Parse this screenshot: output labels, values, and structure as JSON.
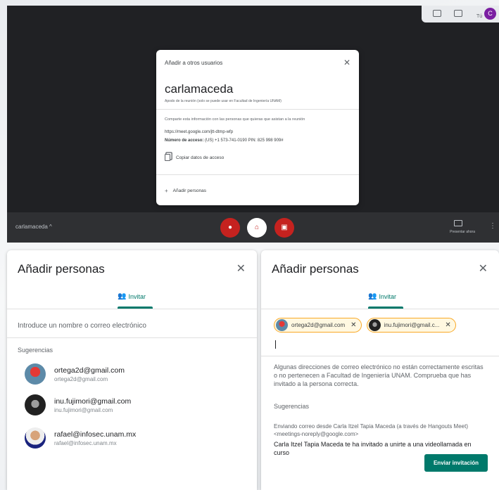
{
  "meet": {
    "top_icons": [
      "people-icon",
      "chat-icon",
      "activities-icon"
    ],
    "top_tu": "Tú",
    "top_avatar": "C",
    "dialog": {
      "title": "Añadir a otros usuarios",
      "meeting_name": "carlamaceda",
      "meeting_sub": "Apodo de la reunión (solo se puede usar en Facultad de Ingeniería UNAM)",
      "share_text": "Comparte esta información con las personas que quieras que asistan a la reunión",
      "link": "https://meet.google.com/jtt-dtmp-wfp",
      "access_label": "Número de acceso:",
      "access_value": "(US) +1 573-741-0190  PIN: 825 998 909#",
      "copy_label": "Copiar datos de acceso",
      "add_label": "Añadir personas"
    },
    "bottombar": {
      "meeting_name": "carlamaceda  ^",
      "present_label": "Presentar ahora",
      "colors": {
        "end_call": "#c5221f",
        "muted": "#c5221f"
      }
    }
  },
  "left_panel": {
    "title": "Añadir personas",
    "close": "✕",
    "tab_label": "Invitar",
    "input_placeholder": "Introduce un nombre o correo electrónico",
    "suggestions_label": "Sugerencias",
    "suggestions": [
      {
        "name": "ortega2d@gmail.com",
        "email": "ortega2d@gmail.com"
      },
      {
        "name": "inu.fujimori@gmail.com",
        "email": "inu.fujimori@gmail.com"
      },
      {
        "name": "rafael@infosec.unam.mx",
        "email": "rafael@infosec.unam.mx"
      }
    ]
  },
  "right_panel": {
    "title": "Añadir personas",
    "close": "✕",
    "tab_label": "Invitar",
    "chips": [
      {
        "label": "ortega2d@gmail.com"
      },
      {
        "label": "inu.fujimori@gmail.c..."
      }
    ],
    "warning": "Algunas direcciones de correo electrónico no están correctamente escritas o no pertenecen a Facultad de Ingeniería UNAM. Comprueba que has invitado a la persona correcta.",
    "suggestions_label": "Sugerencias",
    "sending_text": "Enviando correo desde Carla Itzel Tapia Maceda (a través de Hangouts Meet) <meetings-noreply@google.com>",
    "invite_message": "Carla Itzel Tapia Maceda te ha invitado a unirte a una videollamada en curso",
    "send_button": "Enviar invitación",
    "accent_color": "#00796b"
  }
}
